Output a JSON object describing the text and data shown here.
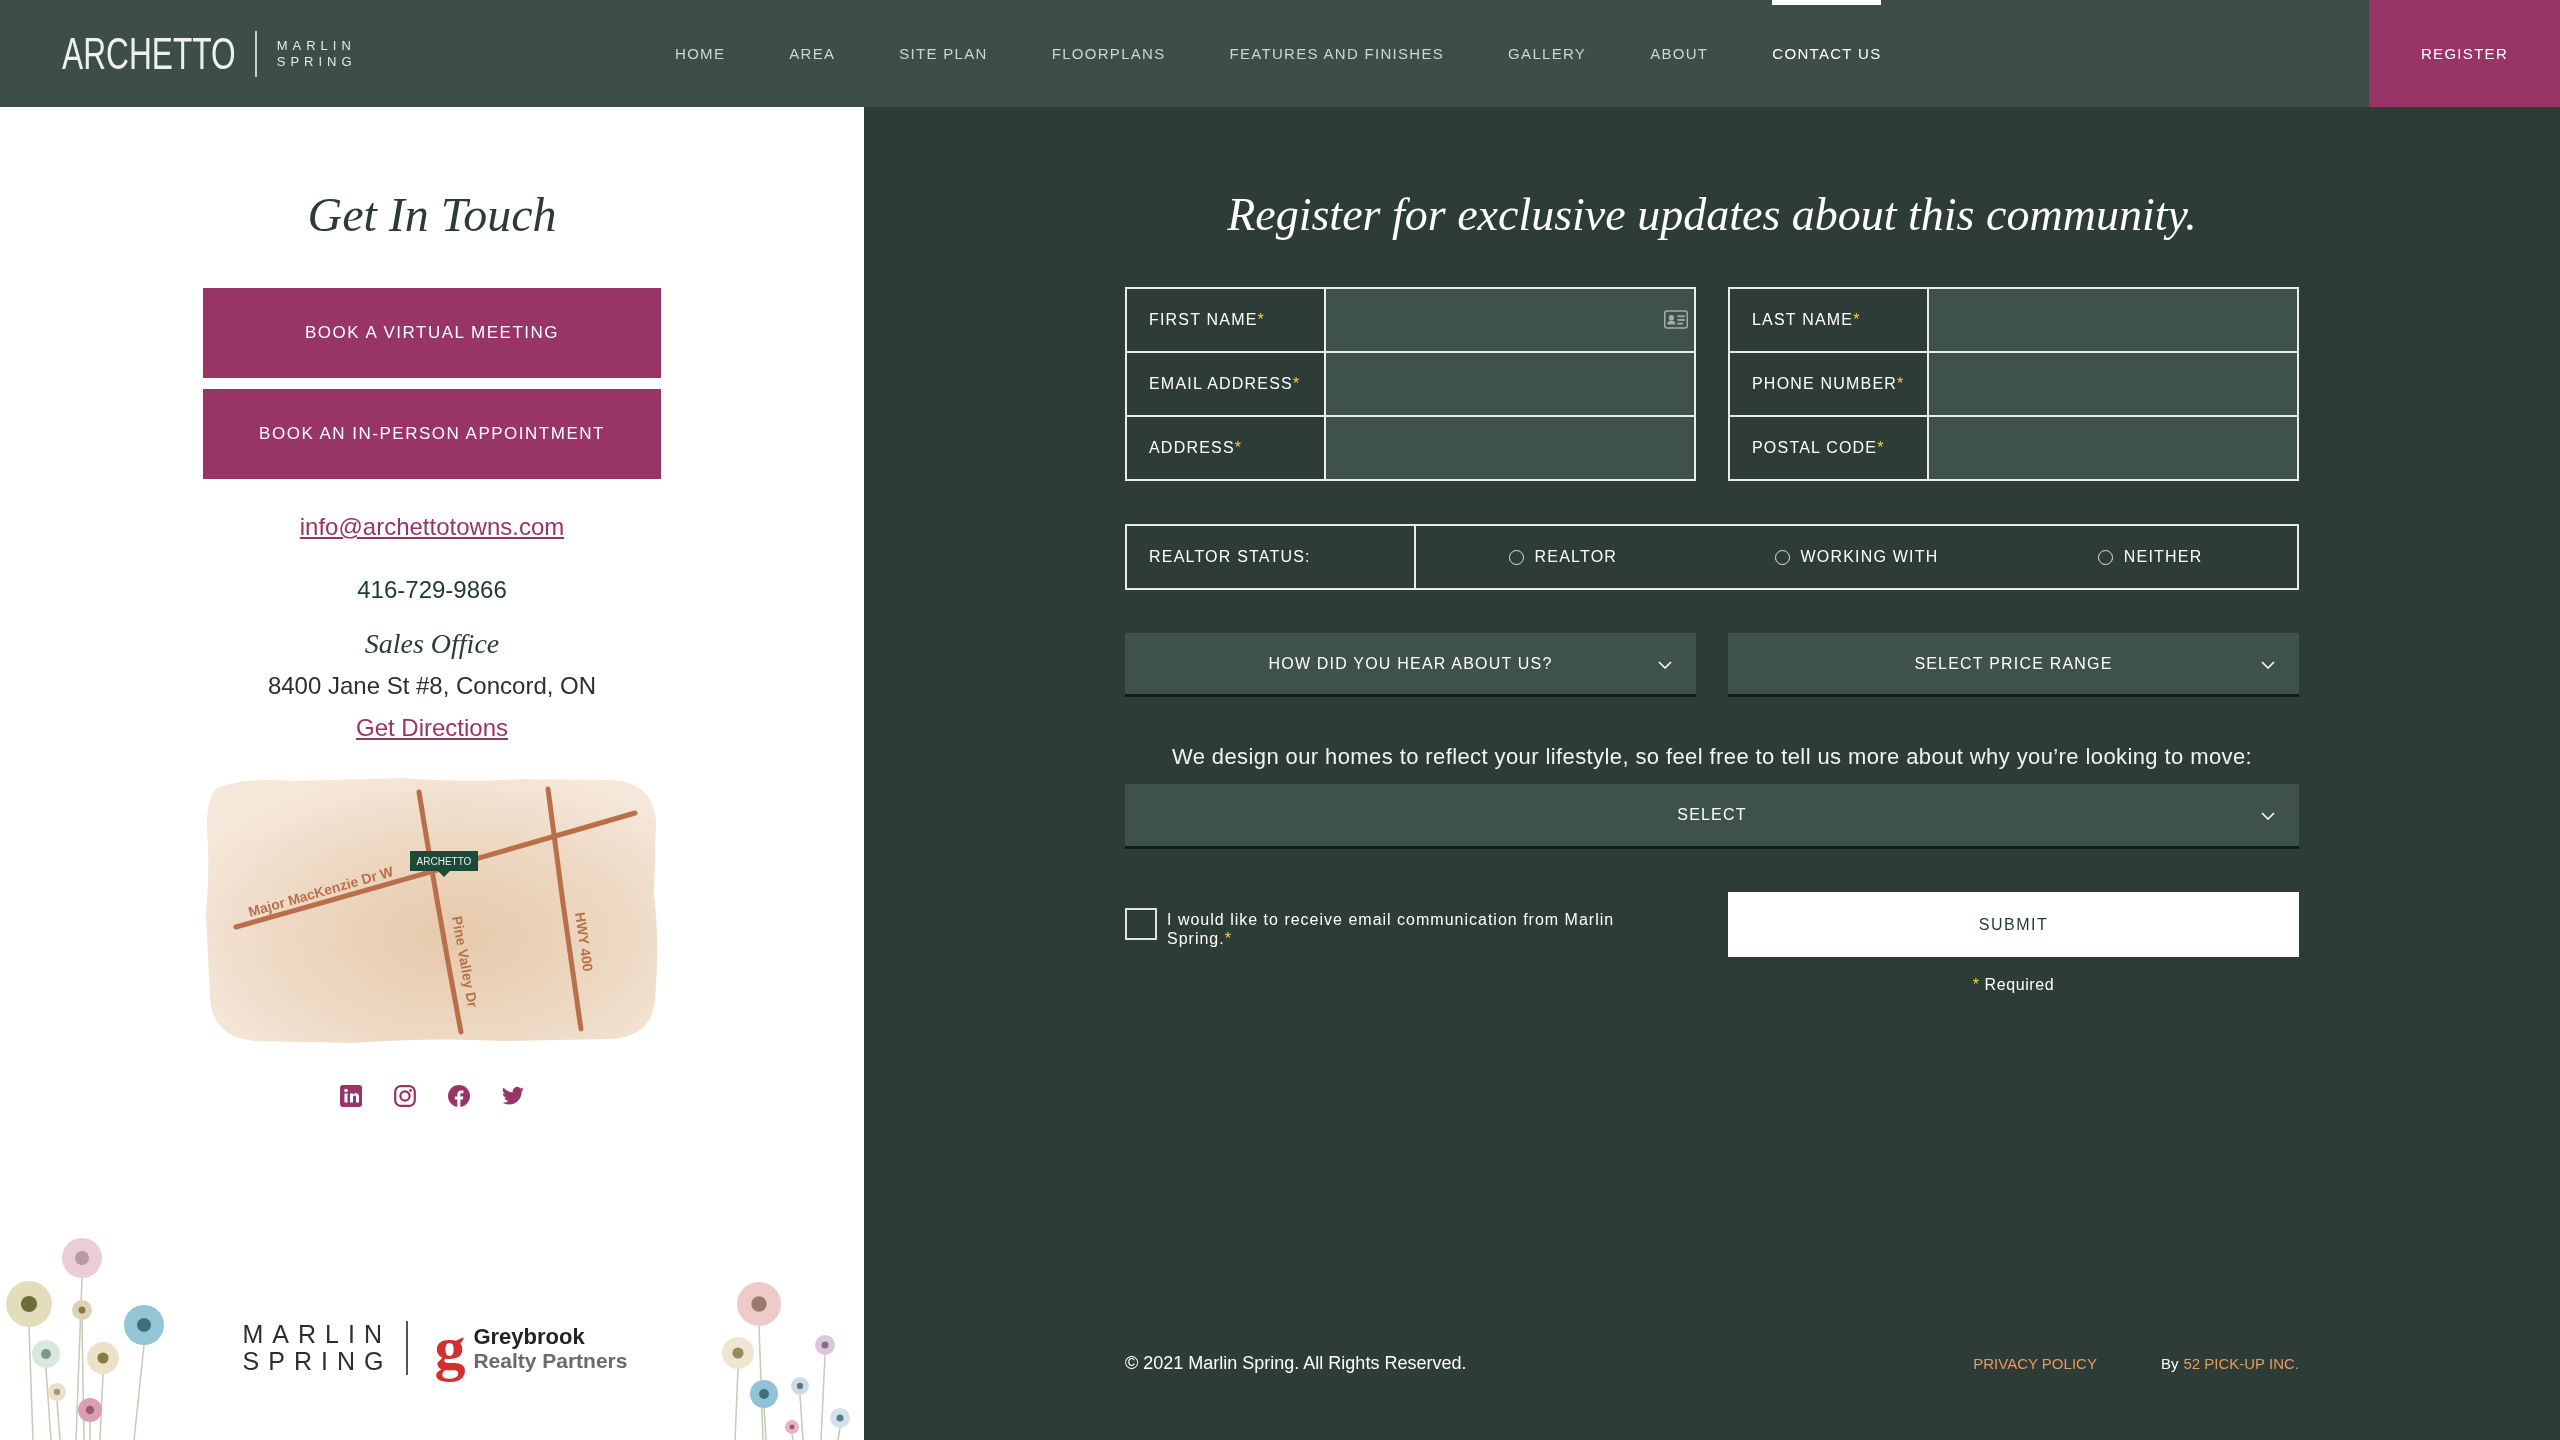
{
  "header": {
    "logo": "ARCHETTO",
    "brand": [
      "MARLIN",
      "SPRING"
    ],
    "nav": [
      {
        "label": "HOME",
        "selected": false
      },
      {
        "label": "AREA",
        "selected": false
      },
      {
        "label": "SITE PLAN",
        "selected": false
      },
      {
        "label": "FLOORPLANS",
        "selected": false
      },
      {
        "label": "FEATURES AND FINISHES",
        "selected": false
      },
      {
        "label": "GALLERY",
        "selected": false
      },
      {
        "label": "ABOUT",
        "selected": false
      },
      {
        "label": "CONTACT US",
        "selected": true
      }
    ],
    "register_button": "REGISTER"
  },
  "contact_panel": {
    "title": "Get In Touch",
    "buttons": [
      "BOOK A VIRTUAL MEETING",
      "BOOK AN IN-PERSON APPOINTMENT"
    ],
    "email": "info@archettotowns.com",
    "phone": "416-729-9866",
    "office_title": "Sales Office",
    "address": "8400 Jane St #8, Concord, ON",
    "directions_link": "Get Directions",
    "map": {
      "marker": "ARCHETTO",
      "roads": [
        {
          "label": "Major MacKenzie Dr W"
        },
        {
          "label": "Pine Valley Dr"
        },
        {
          "label": "HWY 400"
        }
      ]
    },
    "footer_logos": {
      "developer": [
        "MARLIN",
        "SPRING"
      ],
      "partner": {
        "mark": "g",
        "name": "Greybrook",
        "subtitle": "Realty Partners"
      }
    }
  },
  "register_panel": {
    "title": "Register for exclusive updates about this community.",
    "field_groups": [
      {
        "fields": [
          {
            "label": "FIRST NAME",
            "required_mark": "*",
            "autofill": true
          },
          {
            "label": "EMAIL ADDRESS",
            "required_mark": "*",
            "autofill": false
          },
          {
            "label": "ADDRESS",
            "required_mark": "*",
            "autofill": false
          }
        ]
      },
      {
        "fields": [
          {
            "label": "LAST NAME",
            "required_mark": "*",
            "autofill": false
          },
          {
            "label": "PHONE NUMBER",
            "required_mark": "*",
            "autofill": false
          },
          {
            "label": "POSTAL CODE",
            "required_mark": "*",
            "autofill": false
          }
        ]
      }
    ],
    "realtor_status": {
      "label": "REALTOR STATUS:",
      "options": [
        {
          "label": "REALTOR",
          "selected": false
        },
        {
          "label": "WORKING WITH",
          "selected": false
        },
        {
          "label": "NEITHER",
          "selected": false
        }
      ]
    },
    "dropdowns": [
      {
        "value": "HOW DID YOU HEAR ABOUT US?"
      },
      {
        "value": "SELECT PRICE RANGE"
      }
    ],
    "prompt": "We design our homes to reflect your lifestyle, so feel free to tell us more about why you’re looking to move:",
    "reason_select": {
      "value": "SELECT"
    },
    "consent": {
      "text": "I would like to receive email communication from Marlin Spring.",
      "required_mark": "*",
      "checked": false
    },
    "submit_button": "SUBMIT",
    "required_note": {
      "mark": "*",
      "text": "Required"
    }
  },
  "footer": {
    "copyright": "© 2021 Marlin Spring. All Rights Reserved.",
    "privacy_link": "PRIVACY POLICY",
    "credit_label": "By",
    "credit_link": "52 PICK-UP INC."
  }
}
